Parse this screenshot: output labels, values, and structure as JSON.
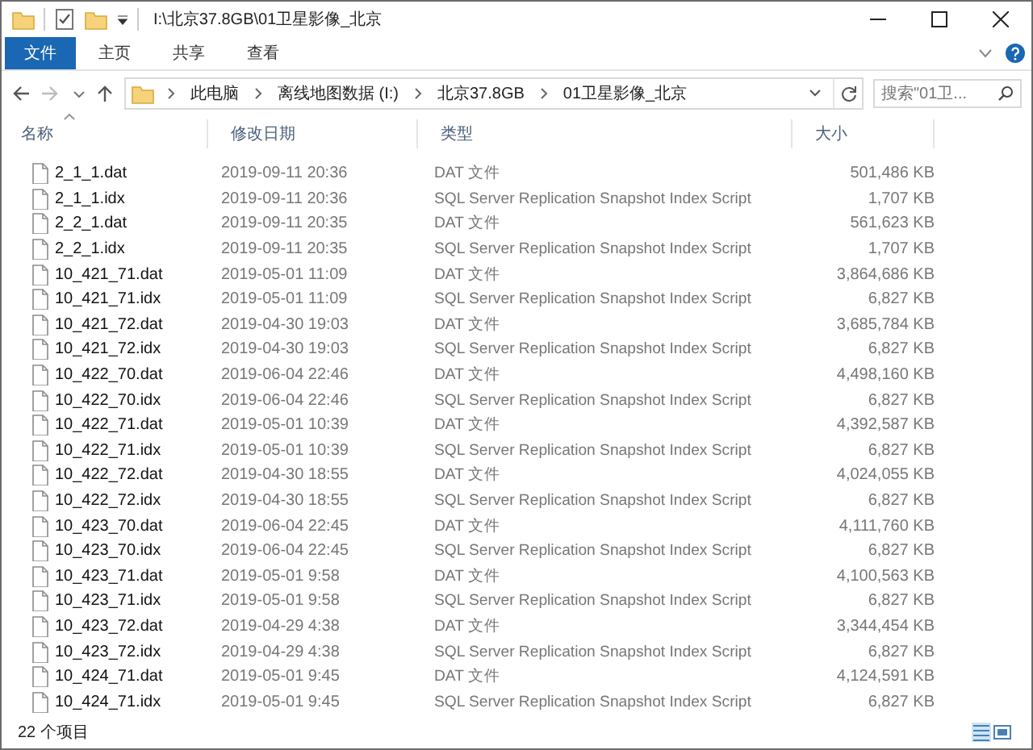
{
  "window": {
    "title": "I:\\北京37.8GB\\01卫星影像_北京"
  },
  "ribbon": {
    "tabs": [
      {
        "label": "文件",
        "selected": true
      },
      {
        "label": "主页",
        "selected": false
      },
      {
        "label": "共享",
        "selected": false
      },
      {
        "label": "查看",
        "selected": false
      }
    ]
  },
  "address": {
    "crumbs": [
      "此电脑",
      "离线地图数据 (I:)",
      "北京37.8GB",
      "01卫星影像_北京"
    ]
  },
  "search": {
    "placeholder": "搜索\"01卫..."
  },
  "columns": [
    "名称",
    "修改日期",
    "类型",
    "大小"
  ],
  "rows": [
    {
      "name": "2_1_1.dat",
      "date": "2019-09-11 20:36",
      "type": "DAT 文件",
      "size": "501,486 KB"
    },
    {
      "name": "2_1_1.idx",
      "date": "2019-09-11 20:36",
      "type": "SQL Server Replication Snapshot Index Script",
      "size": "1,707 KB"
    },
    {
      "name": "2_2_1.dat",
      "date": "2019-09-11 20:35",
      "type": "DAT 文件",
      "size": "561,623 KB"
    },
    {
      "name": "2_2_1.idx",
      "date": "2019-09-11 20:35",
      "type": "SQL Server Replication Snapshot Index Script",
      "size": "1,707 KB"
    },
    {
      "name": "10_421_71.dat",
      "date": "2019-05-01 11:09",
      "type": "DAT 文件",
      "size": "3,864,686 KB"
    },
    {
      "name": "10_421_71.idx",
      "date": "2019-05-01 11:09",
      "type": "SQL Server Replication Snapshot Index Script",
      "size": "6,827 KB"
    },
    {
      "name": "10_421_72.dat",
      "date": "2019-04-30 19:03",
      "type": "DAT 文件",
      "size": "3,685,784 KB"
    },
    {
      "name": "10_421_72.idx",
      "date": "2019-04-30 19:03",
      "type": "SQL Server Replication Snapshot Index Script",
      "size": "6,827 KB"
    },
    {
      "name": "10_422_70.dat",
      "date": "2019-06-04 22:46",
      "type": "DAT 文件",
      "size": "4,498,160 KB"
    },
    {
      "name": "10_422_70.idx",
      "date": "2019-06-04 22:46",
      "type": "SQL Server Replication Snapshot Index Script",
      "size": "6,827 KB"
    },
    {
      "name": "10_422_71.dat",
      "date": "2019-05-01 10:39",
      "type": "DAT 文件",
      "size": "4,392,587 KB"
    },
    {
      "name": "10_422_71.idx",
      "date": "2019-05-01 10:39",
      "type": "SQL Server Replication Snapshot Index Script",
      "size": "6,827 KB"
    },
    {
      "name": "10_422_72.dat",
      "date": "2019-04-30 18:55",
      "type": "DAT 文件",
      "size": "4,024,055 KB"
    },
    {
      "name": "10_422_72.idx",
      "date": "2019-04-30 18:55",
      "type": "SQL Server Replication Snapshot Index Script",
      "size": "6,827 KB"
    },
    {
      "name": "10_423_70.dat",
      "date": "2019-06-04 22:45",
      "type": "DAT 文件",
      "size": "4,111,760 KB"
    },
    {
      "name": "10_423_70.idx",
      "date": "2019-06-04 22:45",
      "type": "SQL Server Replication Snapshot Index Script",
      "size": "6,827 KB"
    },
    {
      "name": "10_423_71.dat",
      "date": "2019-05-01 9:58",
      "type": "DAT 文件",
      "size": "4,100,563 KB"
    },
    {
      "name": "10_423_71.idx",
      "date": "2019-05-01 9:58",
      "type": "SQL Server Replication Snapshot Index Script",
      "size": "6,827 KB"
    },
    {
      "name": "10_423_72.dat",
      "date": "2019-04-29 4:38",
      "type": "DAT 文件",
      "size": "3,344,454 KB"
    },
    {
      "name": "10_423_72.idx",
      "date": "2019-04-29 4:38",
      "type": "SQL Server Replication Snapshot Index Script",
      "size": "6,827 KB"
    },
    {
      "name": "10_424_71.dat",
      "date": "2019-05-01 9:45",
      "type": "DAT 文件",
      "size": "4,124,591 KB"
    },
    {
      "name": "10_424_71.idx",
      "date": "2019-05-01 9:45",
      "type": "SQL Server Replication Snapshot Index Script",
      "size": "6,827 KB"
    }
  ],
  "status_bar": {
    "count": "22 个项目"
  }
}
